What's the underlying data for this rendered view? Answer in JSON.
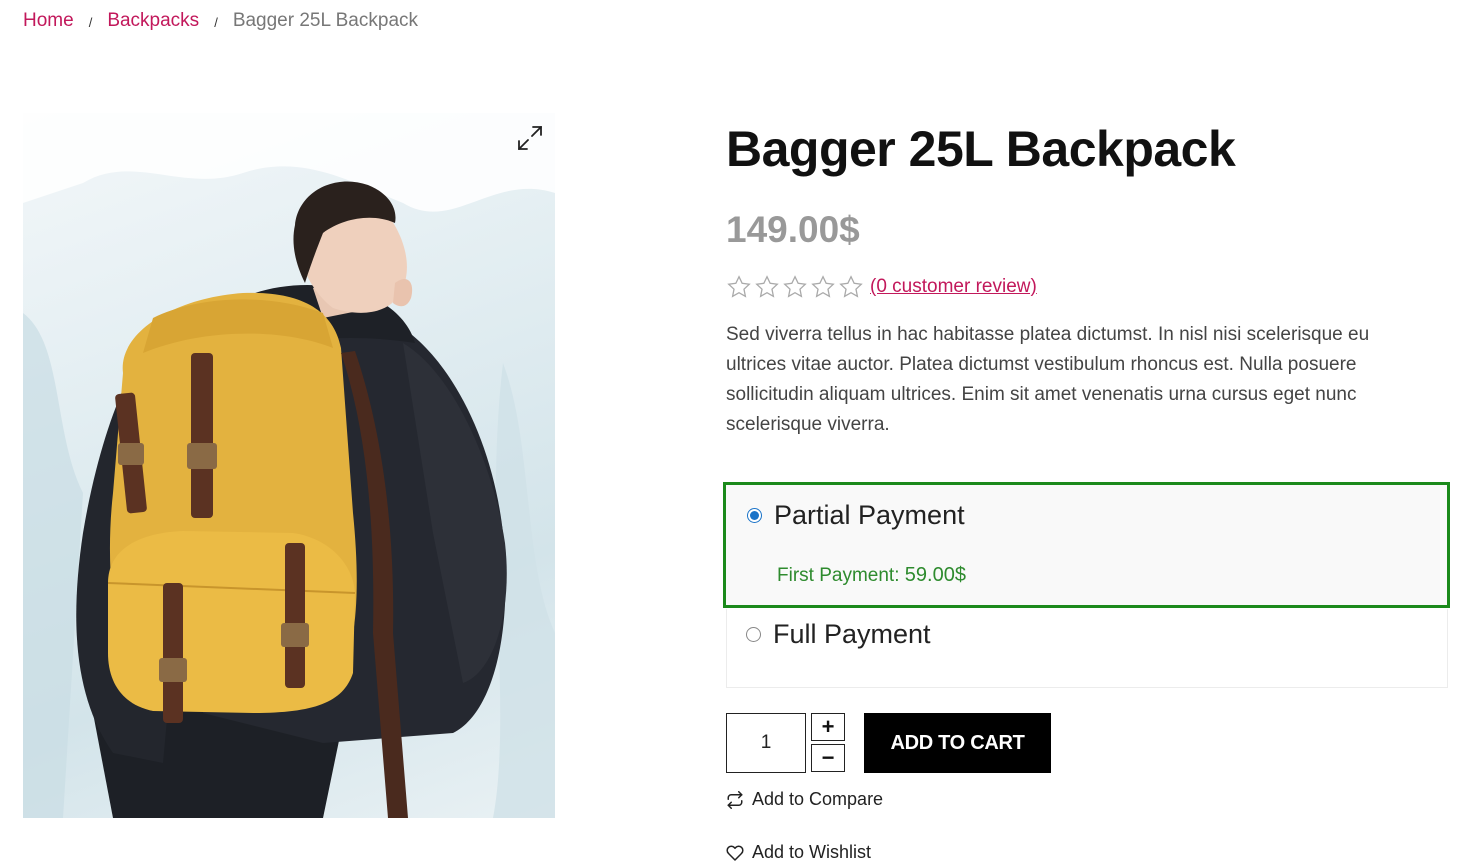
{
  "breadcrumb": {
    "home": "Home",
    "category": "Backpacks",
    "current": "Bagger 25L Backpack",
    "separator": "/"
  },
  "product": {
    "title": "Bagger 25L Backpack",
    "price": "149.00$",
    "rating": {
      "stars": 0,
      "max": 5,
      "review_link": "(0 customer review)"
    },
    "description": "Sed viverra tellus in hac habitasse platea dictumst. In nisl nisi scelerisque eu ultrices vitae auctor. Platea dictumst vestibulum rhoncus est. Nulla posuere sollicitudin aliquam ultrices. Enim sit amet venenatis urna cursus eget nunc scelerisque viverra.",
    "image_icon": "zoom-expand-icon"
  },
  "payment": {
    "partial": {
      "label": "Partial Payment",
      "checked": true,
      "first_payment_label": "First Payment:",
      "first_payment_value": "59.00$"
    },
    "full": {
      "label": "Full Payment",
      "checked": false
    }
  },
  "cart": {
    "quantity": "1",
    "plus": "+",
    "minus": "−",
    "add_to_cart": "ADD TO CART"
  },
  "actions": {
    "compare": "Add to Compare",
    "wishlist": "Add to Wishlist"
  },
  "colors": {
    "accent": "#c2185b",
    "highlight_border": "#1b8a1b",
    "radio": "#1a73c8"
  }
}
